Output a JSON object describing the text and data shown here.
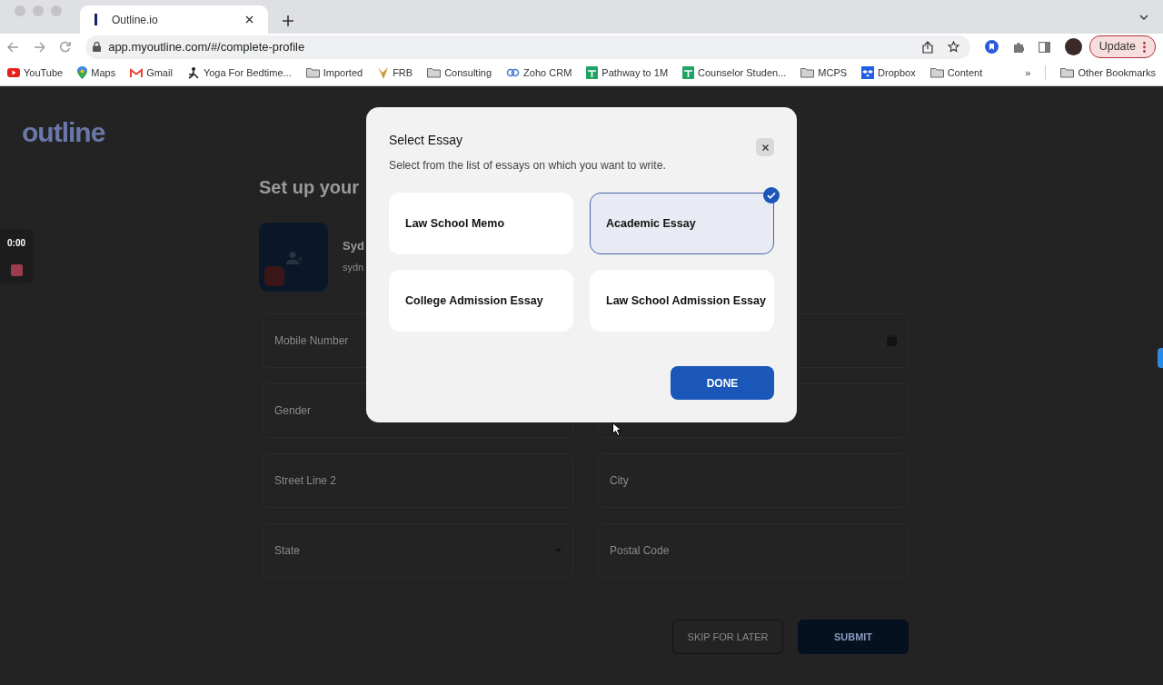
{
  "browser": {
    "tab": {
      "title": "Outline.io",
      "selected": true
    },
    "url": "app.myoutline.com/#/complete-profile",
    "update_button": "Update",
    "bookmarks": [
      {
        "label": "YouTube",
        "kind": "youtube"
      },
      {
        "label": "Maps",
        "kind": "maps"
      },
      {
        "label": "Gmail",
        "kind": "gmail"
      },
      {
        "label": "Yoga For Bedtime...",
        "kind": "figure"
      },
      {
        "label": "Imported",
        "kind": "folder"
      },
      {
        "label": "FRB",
        "kind": "bird"
      },
      {
        "label": "Consulting",
        "kind": "folder"
      },
      {
        "label": "Zoho CRM",
        "kind": "rings"
      },
      {
        "label": "Pathway to 1M",
        "kind": "sheet"
      },
      {
        "label": "Counselor Studen...",
        "kind": "sheet"
      },
      {
        "label": "MCPS",
        "kind": "folder"
      },
      {
        "label": "Dropbox",
        "kind": "dropbox"
      },
      {
        "label": "Content",
        "kind": "folder"
      }
    ],
    "overflow": "»",
    "other_bookmarks": "Other Bookmarks"
  },
  "recorder": {
    "time": "0:00"
  },
  "page": {
    "logo": "outline",
    "heading": "Set up your",
    "profile": {
      "name": "Syd",
      "email": "sydn"
    },
    "fields": [
      {
        "label": "Mobile Number",
        "kind": "text"
      },
      {
        "kind": "date"
      },
      {
        "label": "Gender",
        "kind": "text"
      },
      {
        "kind": "text"
      },
      {
        "label": "Street Line 2",
        "kind": "text"
      },
      {
        "label": "City",
        "kind": "text"
      },
      {
        "label": "State",
        "kind": "select"
      },
      {
        "label": "Postal Code",
        "kind": "text"
      }
    ],
    "buttons": [
      {
        "label": "SKIP FOR LATER",
        "kind": "outline"
      },
      {
        "label": "SUBMIT",
        "kind": "primary"
      }
    ]
  },
  "modal": {
    "title": "Select Essay",
    "subtitle": "Select from the list of essays on which you want to write.",
    "options": [
      {
        "label": "Law School Memo",
        "selected": false
      },
      {
        "label": "Academic Essay",
        "selected": true
      },
      {
        "label": "College Admission Essay",
        "selected": false
      },
      {
        "label": "Law School Admission Essay",
        "selected": false
      }
    ],
    "done_button": "DONE"
  }
}
